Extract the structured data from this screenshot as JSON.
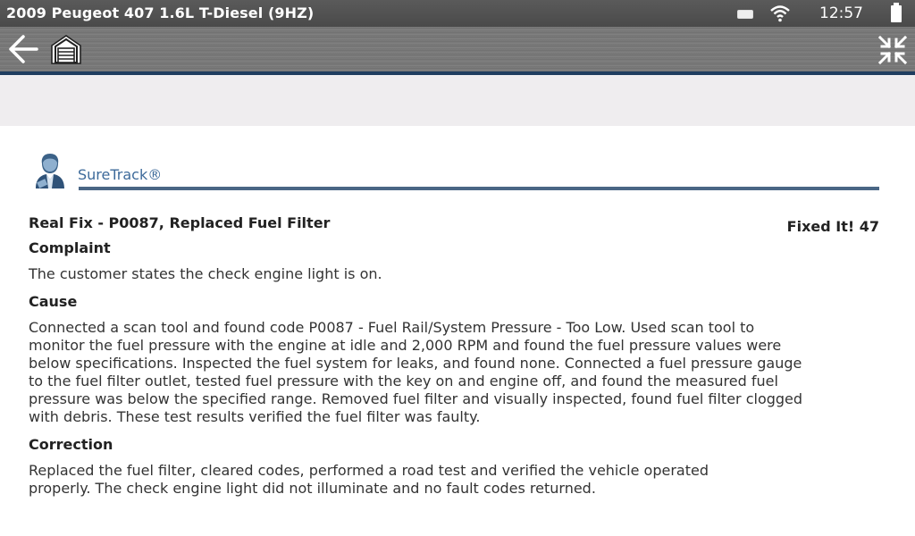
{
  "status_bar": {
    "vehicle_title": "2009 Peugeot 407 1.6L T-Diesel (9HZ)",
    "time": "12:57",
    "icons": [
      "battery-saver-icon",
      "wifi-icon",
      "battery-icon"
    ]
  },
  "toolbar": {
    "icons": [
      "back-arrow-icon",
      "home-garage-icon",
      "collapse-icon"
    ],
    "accent_color": "#1f3d5f"
  },
  "suretrack": {
    "brand": "SureTrack®",
    "brand_color": "#3d6a9a"
  },
  "real_fix": {
    "title": "Real Fix - P0087, Replaced Fuel Filter",
    "fixed_it": "Fixed It! 47",
    "complaint_heading": "Complaint",
    "complaint_text": "The customer states the check engine light is on.",
    "cause_heading": "Cause",
    "cause_lines": [
      "Connected a scan tool and found code P0087 - Fuel Rail/System Pressure - Too Low. Used scan tool to",
      "monitor the fuel pressure with the engine at idle and 2,000 RPM and found the fuel pressure values were",
      "below specifications. Inspected the fuel system for leaks, and found none. Connected a fuel pressure gauge",
      "to the fuel filter outlet, tested fuel pressure with the key on and engine off, and found the measured fuel",
      "pressure was below the specified range. Removed fuel filter and visually inspected, found fuel filter clogged",
      "with debris. These test results verified the fuel filter was faulty."
    ],
    "correction_heading": "Correction",
    "correction_lines": [
      "Replaced the fuel filter, cleared codes, performed a road test and verified the vehicle operated",
      "properly. The check engine light did not illuminate and no fault codes returned."
    ]
  }
}
